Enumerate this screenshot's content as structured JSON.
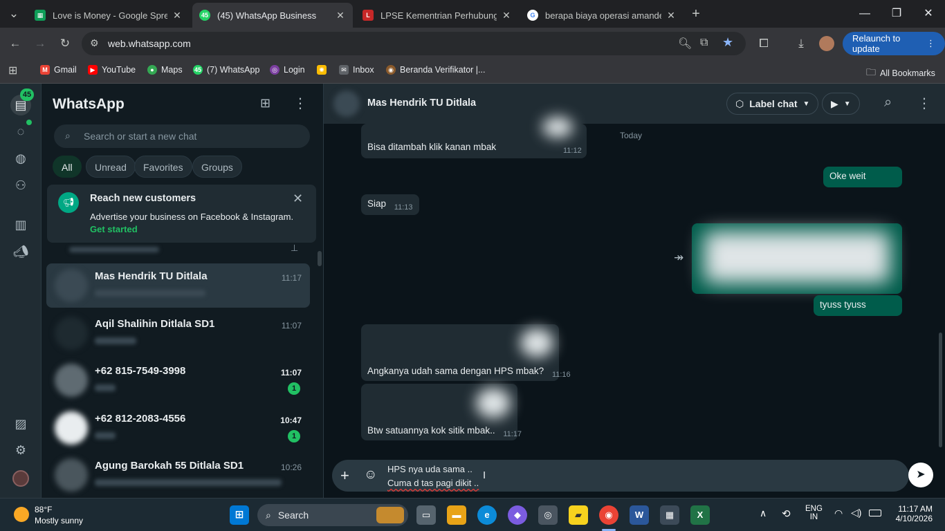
{
  "browser": {
    "tabs": [
      {
        "title": "Love is Money - Google Spread",
        "favicon": "sheets-icon",
        "color": "#0f9d58"
      },
      {
        "title": "(45) WhatsApp Business",
        "favicon": "whatsapp-business-icon",
        "color": "#25d366",
        "active": true
      },
      {
        "title": "LPSE Kementrian Perhubungan",
        "favicon": "lpse-icon",
        "color": "#c62828"
      },
      {
        "title": "berapa biaya operasi amandel",
        "favicon": "google-icon",
        "color": "#4285f4"
      }
    ],
    "url": "web.whatsapp.com",
    "relaunch_label": "Relaunch to update",
    "bookmarks": [
      "Gmail",
      "YouTube",
      "Maps",
      "(7) WhatsApp",
      "Login",
      "Inbox",
      "Beranda Verifikator |..."
    ],
    "all_bookmarks_label": "All Bookmarks"
  },
  "rail": {
    "unread_count": "45"
  },
  "sidebar": {
    "title": "WhatsApp",
    "search_placeholder": "Search or start a new chat",
    "filters": [
      "All",
      "Unread",
      "Favorites",
      "Groups"
    ],
    "promo": {
      "title": "Reach new customers",
      "body": "Advertise your business on Facebook & Instagram.",
      "cta": "Get started"
    },
    "chats": [
      {
        "name": "Mas Hendrik TU Ditlala",
        "time": "11:17",
        "selected": true
      },
      {
        "name": "Aqil Shalihin Ditlala SD1",
        "time": "11:07"
      },
      {
        "name": "+62 815-7549-3998",
        "time": "11:07",
        "unread": "1"
      },
      {
        "name": "+62 812-2083-4556",
        "time": "10:47",
        "unread": "1"
      },
      {
        "name": "Agung Barokah 55 Ditlala SD1",
        "time": "10:26"
      }
    ]
  },
  "chat": {
    "contact_name": "Mas Hendrik TU Ditlala",
    "label_chat": "Label chat",
    "date_divider": "Today",
    "messages": [
      {
        "dir": "in",
        "text": "Bisa ditambah klik kanan mbak",
        "time": "11:12"
      },
      {
        "dir": "out",
        "text": "Oke weit"
      },
      {
        "dir": "in",
        "text": "Siap",
        "time": "11:13"
      },
      {
        "dir": "out",
        "text": "tyuss tyuss"
      },
      {
        "dir": "in",
        "text": "Angkanya udah sama dengan HPS mbak?",
        "time": "11:16"
      },
      {
        "dir": "in",
        "text": "Btw satuannya kok sitik mbak..",
        "time": "11:17"
      }
    ],
    "composer_lines": [
      "HPS nya uda sama ..",
      "Cuma d tas pagi dikit .."
    ]
  },
  "taskbar": {
    "weather_temp": "88°F",
    "weather_desc": "Mostly sunny",
    "search_label": "Search",
    "lang": "ENG",
    "region": "IN",
    "time": "11:17 AM",
    "date": "4/10/2026"
  }
}
